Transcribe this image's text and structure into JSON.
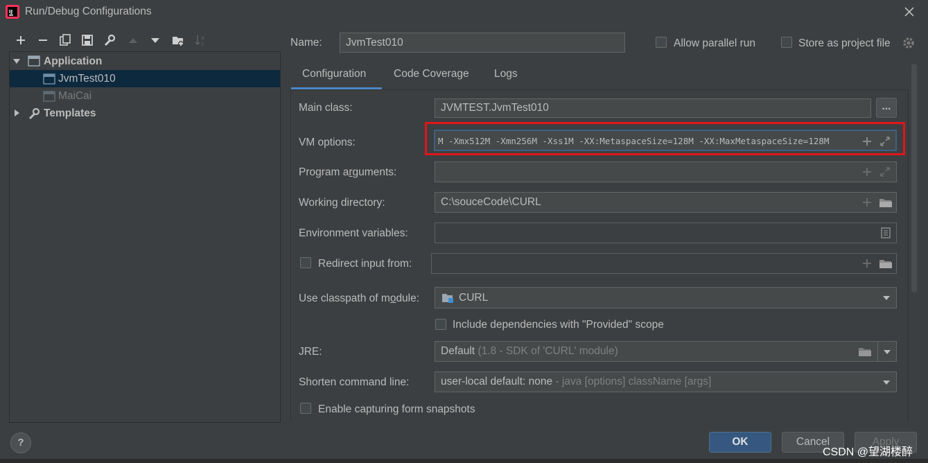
{
  "window": {
    "title": "Run/Debug Configurations"
  },
  "tree": {
    "items": [
      {
        "label": "Application",
        "expanded": true
      },
      {
        "label": "JvmTest010",
        "selected": true
      },
      {
        "label": "MaiCai"
      },
      {
        "label": "Templates",
        "expanded": false
      }
    ]
  },
  "header": {
    "name_label": "Name:",
    "name_value": "JvmTest010",
    "allow_parallel": "Allow parallel run",
    "store_project": "Store as project file"
  },
  "tabs": [
    {
      "label": "Configuration",
      "active": true
    },
    {
      "label": "Code Coverage"
    },
    {
      "label": "Logs"
    }
  ],
  "form": {
    "main_class_label": "Main class:",
    "main_class_value": "JVMTEST.JvmTest010",
    "browse_label": "...",
    "vm_options_label": "VM options:",
    "vm_options_value": "M -Xmx512M -Xmn256M -Xss1M -XX:MetaspaceSize=128M -XX:MaxMetaspaceSize=128M",
    "program_args_label": "Program arguments:",
    "program_args_value": "",
    "working_dir_label": "Working directory:",
    "working_dir_value": "C:\\souceCode\\CURL",
    "env_vars_label": "Environment variables:",
    "env_vars_value": "",
    "redirect_label": "Redirect input from:",
    "classpath_label": "Use classpath of module:",
    "classpath_value": "CURL",
    "include_deps_label": "Include dependencies with \"Provided\" scope",
    "jre_label": "JRE:",
    "jre_value": "Default",
    "jre_hint": "(1.8 - SDK of 'CURL' module)",
    "shorten_label": "Shorten command line:",
    "shorten_value": "user-local default: none",
    "shorten_hint": "- java [options] className [args]",
    "snapshots_label": "Enable capturing form snapshots"
  },
  "buttons": {
    "ok": "OK",
    "cancel": "Cancel",
    "apply": "Apply",
    "help": "?"
  },
  "watermark": "CSDN @望湖楼醉",
  "colors": {
    "highlight_box": "#e0161b",
    "selection": "#0d293e",
    "tab_accent": "#4a88c7",
    "ok_button": "#365880"
  }
}
